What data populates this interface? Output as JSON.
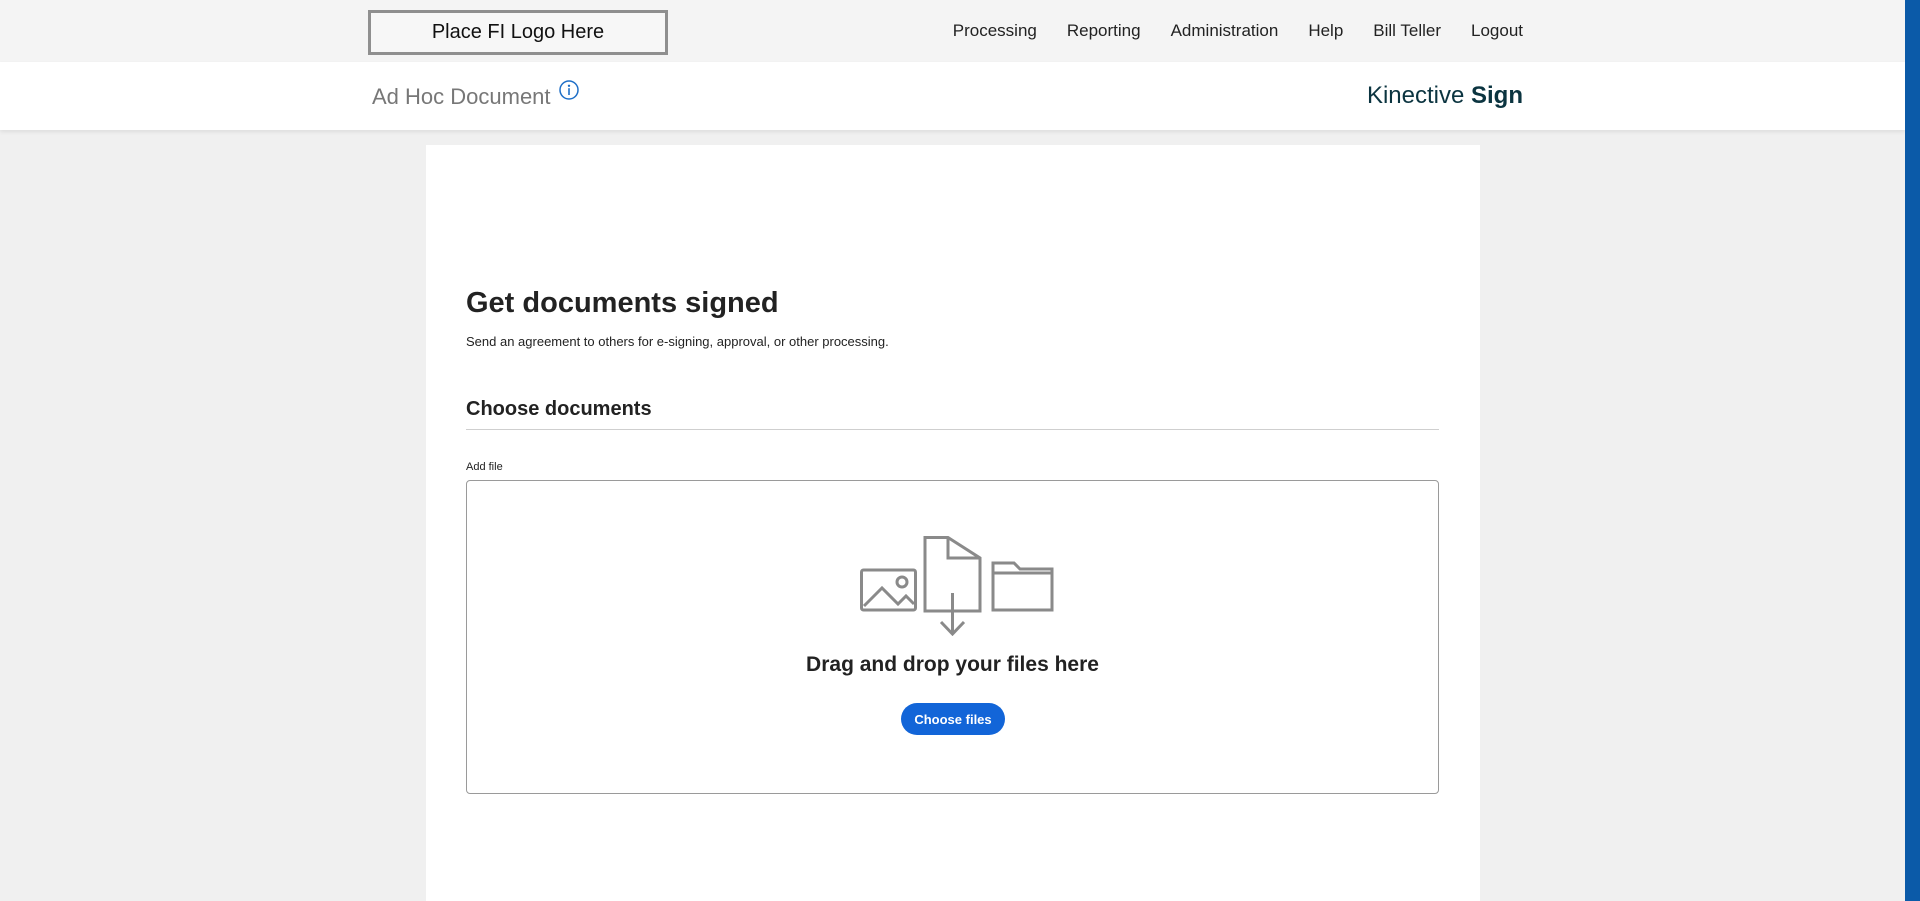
{
  "header": {
    "logo_placeholder": "Place FI Logo Here",
    "nav": [
      "Processing",
      "Reporting",
      "Administration",
      "Help",
      "Bill Teller",
      "Logout"
    ]
  },
  "subheader": {
    "page_title": "Ad Hoc Document",
    "info_icon": "info-circle-icon",
    "brand_prefix": "Kinective",
    "brand_bold": "Sign"
  },
  "main": {
    "heading": "Get documents signed",
    "subtitle": "Send an agreement to others for e-signing, approval, or other processing.",
    "section_title": "Choose documents",
    "add_file_label": "Add file",
    "dropzone": {
      "icons": [
        "image-icon",
        "document-download-icon",
        "folder-icon"
      ],
      "text": "Drag and drop your files here",
      "button_label": "Choose files"
    }
  },
  "colors": {
    "accent": "#1265d8",
    "brand": "#0b3440",
    "info_icon": "#1f6fc7",
    "scroll_accent": "#0b5aa8"
  }
}
